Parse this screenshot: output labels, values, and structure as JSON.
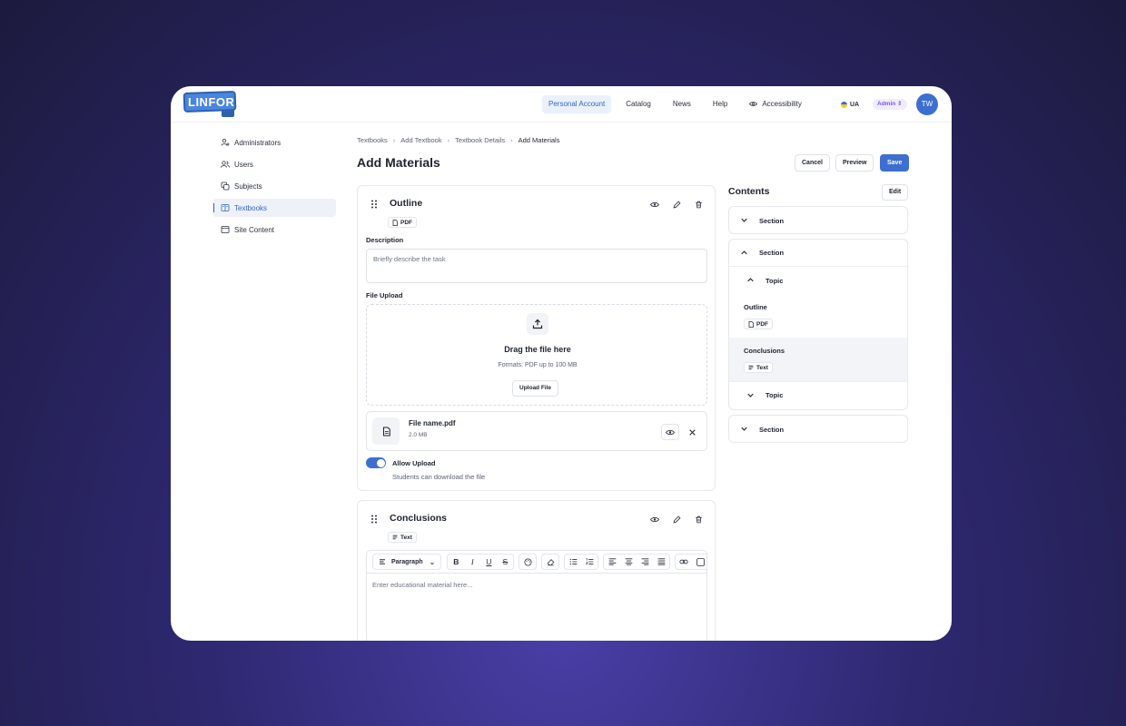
{
  "logo": "LINFOR",
  "nav": {
    "personal_account": "Personal Account",
    "catalog": "Catalog",
    "news": "News",
    "help": "Help",
    "accessibility": "Accessibility",
    "lang": "UA",
    "role": "Admin",
    "avatar": "TW"
  },
  "sidebar": {
    "items": [
      {
        "label": "Administrators",
        "icon": "admin-icon"
      },
      {
        "label": "Users",
        "icon": "users-icon"
      },
      {
        "label": "Subjects",
        "icon": "subjects-icon"
      },
      {
        "label": "Textbooks",
        "icon": "book-icon",
        "active": true
      },
      {
        "label": "Site Content",
        "icon": "site-icon"
      }
    ]
  },
  "breadcrumb": [
    "Textbooks",
    "Add Textbook",
    "Textbook Details",
    "Add Materials"
  ],
  "page_title": "Add Materials",
  "actions": {
    "cancel": "Cancel",
    "preview": "Preview",
    "save": "Save"
  },
  "outline_card": {
    "title": "Outline",
    "tag": "PDF",
    "description_label": "Description",
    "description_placeholder": "Briefly describe the task",
    "upload_label": "File Upload",
    "dropzone_title": "Drag the file here",
    "dropzone_sub": "Formats: PDF up to 100 MB",
    "upload_button": "Upload File",
    "file_name": "File name.pdf",
    "file_size": "2.0 MB",
    "allow_label": "Allow Upload",
    "allow_sub": "Students can download the file",
    "allow_on": true
  },
  "conclusions_card": {
    "title": "Conclusions",
    "tag": "Text",
    "paragraph_select": "Paragraph",
    "editor_placeholder": "Enter educational material here..."
  },
  "contents": {
    "title": "Contents",
    "edit": "Edit",
    "section1": "Section",
    "section2": "Section",
    "topic1": "Topic",
    "item_outline": "Outline",
    "item_outline_tag": "PDF",
    "item_conclusions": "Conclusions",
    "item_conclusions_tag": "Text",
    "topic2": "Topic",
    "section3": "Section"
  },
  "colors": {
    "accent": "#3d6fd0",
    "role_badge": "#7b55e3",
    "background": "#2e2870"
  }
}
